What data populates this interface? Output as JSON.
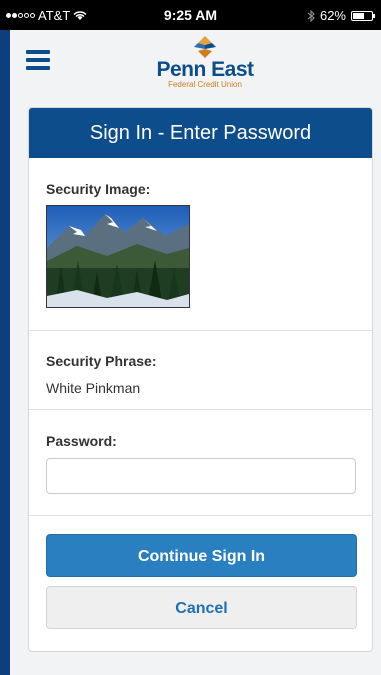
{
  "status_bar": {
    "carrier": "AT&T",
    "time": "9:25 AM",
    "battery": "62%",
    "battery_level": 0.62
  },
  "header": {
    "logo_main": "Penn East",
    "logo_sub": "Federal Credit Union",
    "icons": [
      "menu-icon",
      "diamond-logo-icon"
    ]
  },
  "card": {
    "title": "Sign In - Enter Password",
    "security_image_label": "Security Image:",
    "security_phrase_label": "Security Phrase:",
    "security_phrase_value": "White Pinkman",
    "password_label": "Password:",
    "password_value": "",
    "continue_button": "Continue Sign In",
    "cancel_button": "Cancel"
  },
  "colors": {
    "brand_blue": "#0d4d8b",
    "button_blue": "#2a7fc1",
    "accent_orange": "#d07c1b"
  }
}
